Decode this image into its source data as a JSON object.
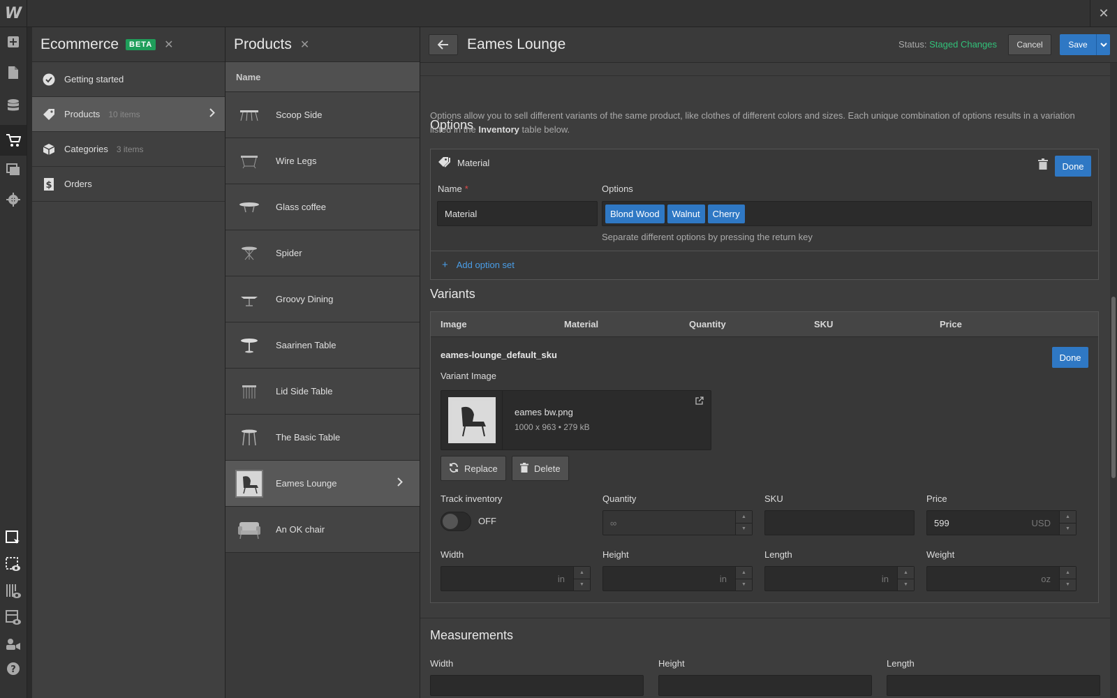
{
  "app": {
    "logo": "W",
    "close": "✕"
  },
  "rail": {
    "icons": [
      "add-icon",
      "pages-icon",
      "cms-icon",
      "ecommerce-icon",
      "assets-icon",
      "settings-icon",
      "select-icon",
      "preview-icon",
      "audit-icon",
      "layout-icon",
      "collaborators-icon",
      "help-icon"
    ]
  },
  "ecommerce_panel": {
    "title": "Ecommerce",
    "badge": "BETA",
    "close": "✕",
    "items": [
      {
        "label": "Getting started",
        "count": ""
      },
      {
        "label": "Products",
        "count": "10 items"
      },
      {
        "label": "Categories",
        "count": "3 items"
      },
      {
        "label": "Orders",
        "count": ""
      }
    ]
  },
  "products_panel": {
    "title": "Products",
    "close": "✕",
    "column_header": "Name",
    "items": [
      "Scoop Side",
      "Wire Legs",
      "Glass coffee",
      "Spider",
      "Groovy Dining",
      "Saarinen Table",
      "Lid Side Table",
      "The Basic Table",
      "Eames Lounge",
      "An OK chair"
    ],
    "selected": "Eames Lounge"
  },
  "detail": {
    "back": "←",
    "title": "Eames Lounge",
    "status_label": "Status:",
    "status_value": "Staged Changes",
    "cancel": "Cancel",
    "save": "Save",
    "status_color": "#32c27a",
    "accent_color": "#2f78c4"
  },
  "options": {
    "title": "Options",
    "description_1": "Options allow you to sell different variants of the same product, like clothes of different colors and sizes. Each unique combination of options results in a variation listed in the ",
    "description_bold": "Inventory",
    "description_2": " table below.",
    "option_set": {
      "label": "Material",
      "done": "Done",
      "name_label": "Name",
      "name_required": "*",
      "name_value": "Material",
      "options_label": "Options",
      "values": [
        "Blond Wood",
        "Walnut",
        "Cherry"
      ],
      "hint": "Separate different options by pressing the return key"
    },
    "add_option_set": "Add option set"
  },
  "variants": {
    "title": "Variants",
    "columns": [
      "Image",
      "Material",
      "Quantity",
      "SKU",
      "Price"
    ],
    "sku_name": "eames-lounge_default_sku",
    "done": "Done",
    "variant_image_label": "Variant Image",
    "file_name": "eames bw.png",
    "file_meta": "1000 x 963 • 279 kB",
    "replace": "Replace",
    "delete": "Delete",
    "track_inventory_label": "Track inventory",
    "track_inventory_state": "OFF",
    "quantity_label": "Quantity",
    "quantity_value": "∞",
    "sku_label": "SKU",
    "sku_value": "",
    "price_label": "Price",
    "price_value": "599",
    "price_currency": "USD",
    "width_label": "Width",
    "width_unit": "in",
    "height_label": "Height",
    "height_unit": "in",
    "length_label": "Length",
    "length_unit": "in",
    "weight_label": "Weight",
    "weight_unit": "oz"
  },
  "measurements": {
    "title": "Measurements",
    "width_label": "Width",
    "height_label": "Height",
    "length_label": "Length"
  }
}
